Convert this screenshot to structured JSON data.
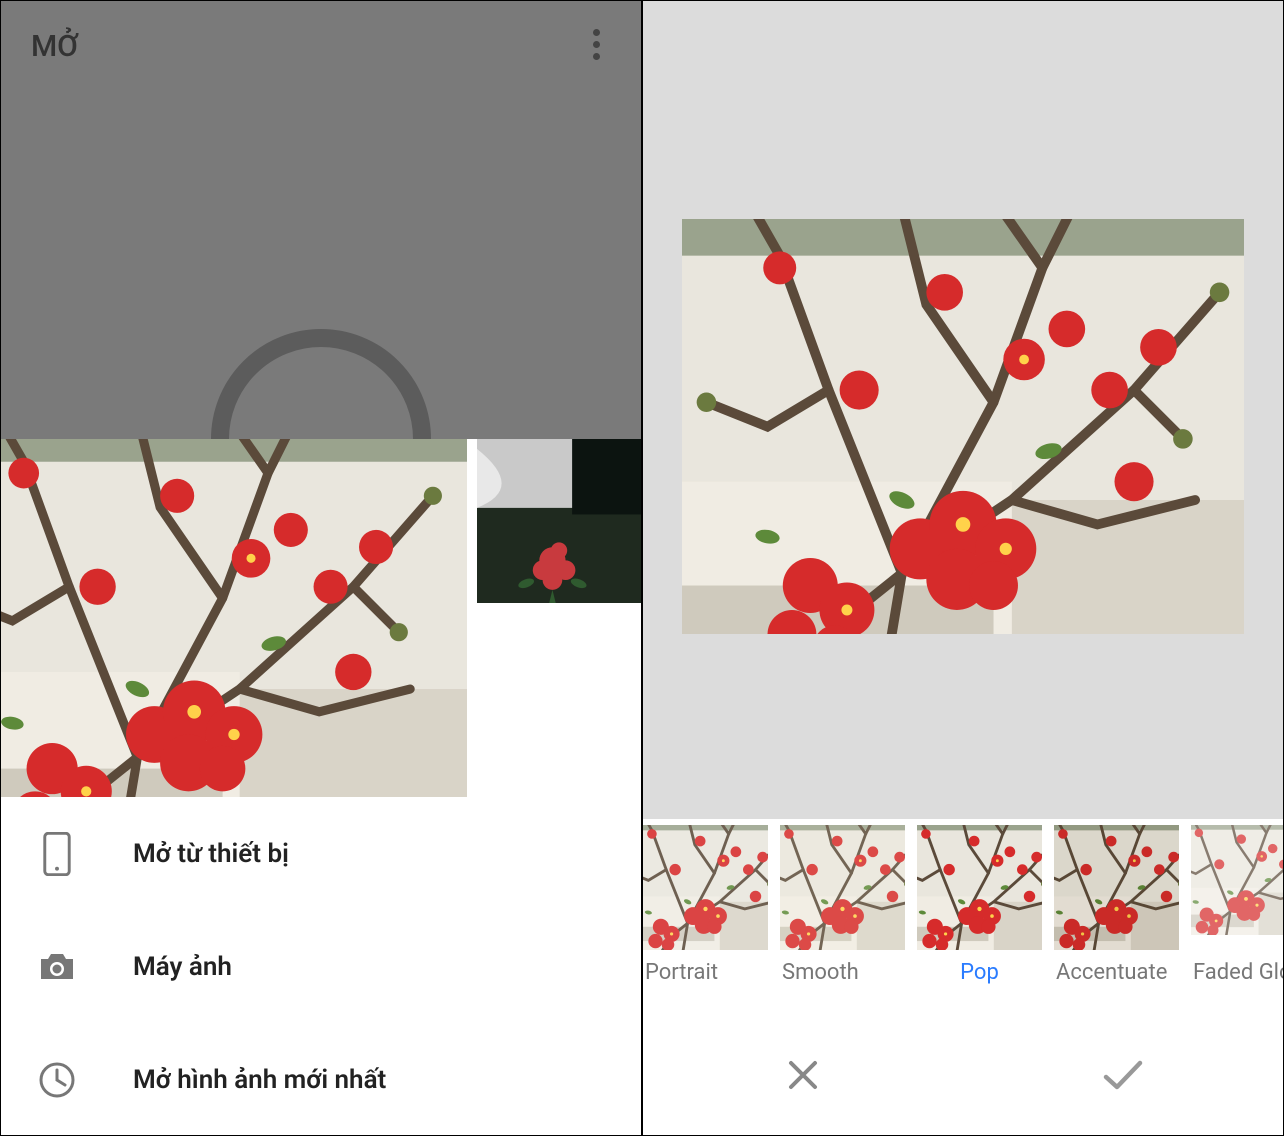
{
  "left": {
    "title": "MỞ",
    "menu": {
      "device": "Mở từ thiết bị",
      "camera": "Máy ảnh",
      "latest": "Mở hình ảnh mới nhất"
    }
  },
  "right": {
    "filters": {
      "portrait": "Portrait",
      "smooth": "Smooth",
      "pop": "Pop",
      "accentuate": "Accentuate",
      "faded_glow": "Faded Glo"
    },
    "selected_filter": "pop"
  },
  "colors": {
    "accent": "#2a7cff",
    "overlay": "#7a7a7a",
    "preview_bg": "#dcdcdc"
  }
}
